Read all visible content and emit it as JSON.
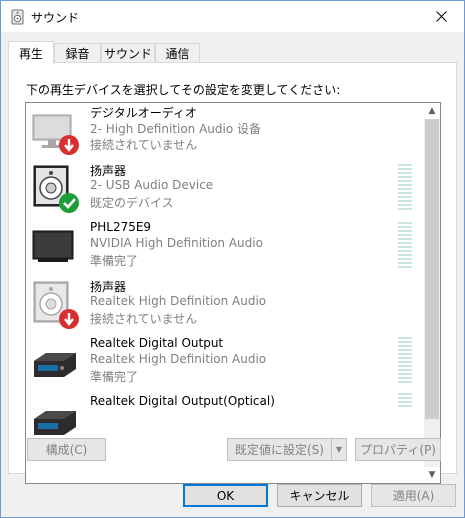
{
  "window": {
    "title": "サウンド",
    "close_icon": "close-icon"
  },
  "tabs": [
    {
      "label": "再生",
      "active": true
    },
    {
      "label": "録音",
      "active": false
    },
    {
      "label": "サウンド",
      "active": false
    },
    {
      "label": "通信",
      "active": false
    }
  ],
  "instruction": "下の再生デバイスを選択してその設定を変更してください:",
  "devices": [
    {
      "name": "デジタルオーディオ",
      "desc": "2- High Definition Audio 设备",
      "status": "接続されていません",
      "icon": "monitor-disconnected-icon",
      "meter": false
    },
    {
      "name": "扬声器",
      "desc": "2- USB Audio Device",
      "status": "既定のデバイス",
      "icon": "speaker-default-icon",
      "meter": true
    },
    {
      "name": "PHL275E9",
      "desc": "NVIDIA High Definition Audio",
      "status": "準備完了",
      "icon": "monitor-icon",
      "meter": true
    },
    {
      "name": "扬声器",
      "desc": "Realtek High Definition Audio",
      "status": "接続されていません",
      "icon": "speaker-disconnected-icon",
      "meter": false
    },
    {
      "name": "Realtek Digital Output",
      "desc": "Realtek High Definition Audio",
      "status": "準備完了",
      "icon": "digital-output-icon",
      "meter": true
    },
    {
      "name": "Realtek Digital Output(Optical)",
      "desc": "",
      "status": "",
      "icon": "digital-output-icon",
      "meter": true
    }
  ],
  "buttons": {
    "configure": "構成(C)",
    "set_default": "既定値に設定(S)",
    "properties": "プロパティ(P)",
    "ok": "OK",
    "cancel": "キャンセル",
    "apply": "適用(A)"
  },
  "colors": {
    "accent": "#0078d7",
    "status_ok": "#1e9e3a",
    "status_error": "#d01818"
  }
}
